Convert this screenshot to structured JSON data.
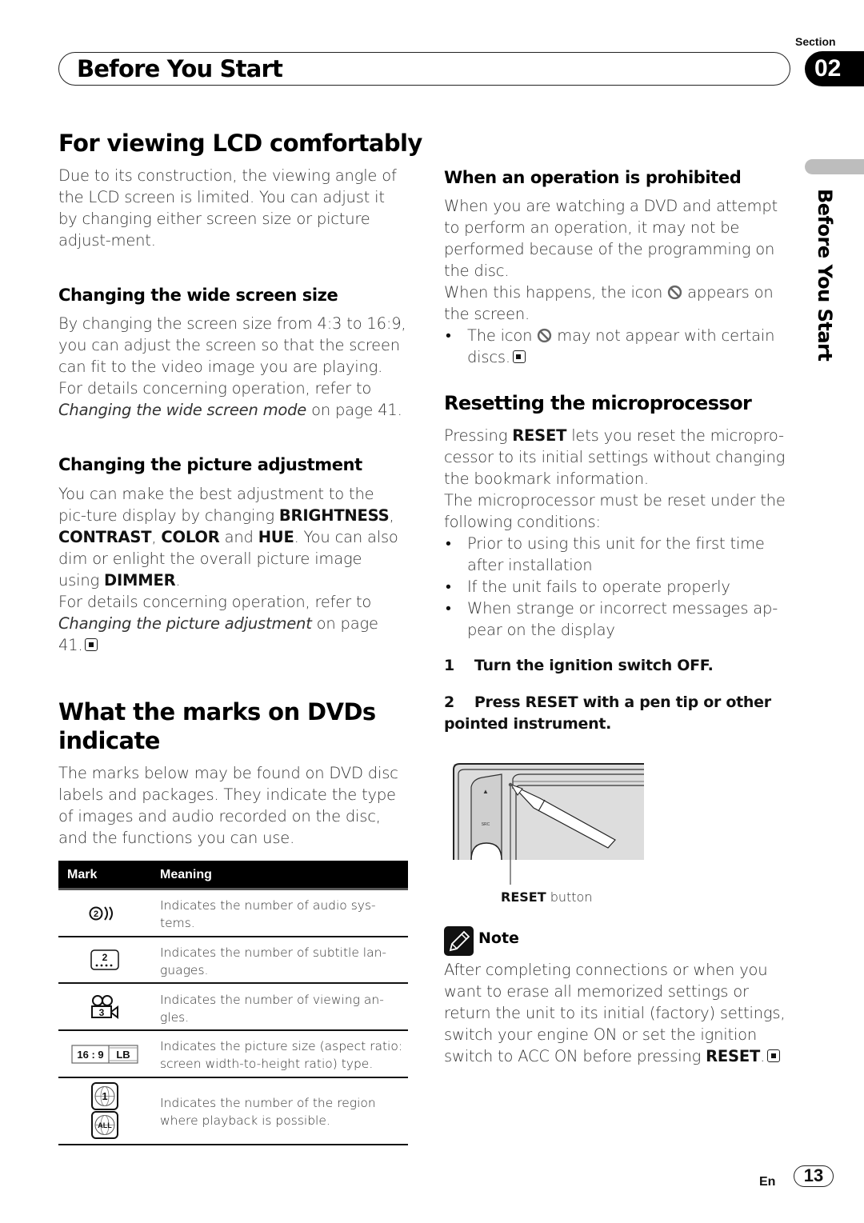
{
  "header": {
    "title": "Before You Start",
    "section_label": "Section",
    "section_number": "02",
    "side_tab": "Before You Start"
  },
  "left": {
    "lcd": {
      "heading": "For viewing LCD comfortably",
      "body": "Due to its construction, the viewing angle of the LCD screen is limited. You can adjust it by changing either screen size or picture adjust-ment."
    },
    "wide": {
      "heading": "Changing the wide screen size",
      "body": "By changing the screen size from 4:3 to 16:9, you can adjust the screen so that the screen can fit to the video image you are playing.",
      "ref_prefix": "For details concerning operation, refer to",
      "ref_link": "Changing the wide screen mode",
      "ref_suffix": " on page 41."
    },
    "picture": {
      "heading": "Changing the picture adjustment",
      "t1": "You can make the best adjustment to the pic-ture display by changing ",
      "k1": "BRIGHTNESS",
      "t2": ", ",
      "k2": "CONTRAST",
      "t3": ", ",
      "k3": "COLOR",
      "t4": " and ",
      "k4": "HUE",
      "t5": ". You can also dim or enlight the overall picture image using ",
      "k5": "DIMMER",
      "t6": ".",
      "ref_prefix": "For details concerning operation, refer to",
      "ref_link": "Changing the picture adjustment",
      "ref_suffix": " on page 41."
    },
    "marks": {
      "heading": "What the marks on DVDs indicate",
      "body": "The marks below may be found on DVD disc labels and packages. They indicate the type of images and audio recorded on the disc, and the functions you can use.",
      "table": {
        "col_mark": "Mark",
        "col_meaning": "Meaning",
        "rows": [
          {
            "icon": "audio-systems-icon",
            "icon_text": "2",
            "meaning": "Indicates the number of audio sys-tems."
          },
          {
            "icon": "subtitle-languages-icon",
            "icon_text": "2",
            "meaning": "Indicates the number of subtitle lan-guages."
          },
          {
            "icon": "viewing-angles-icon",
            "icon_text": "3",
            "meaning": "Indicates the number of viewing an-gles."
          },
          {
            "icon": "aspect-ratio-icon",
            "icon_text": "16 : 9",
            "icon_text2": "LB",
            "meaning": "Indicates the picture size (aspect ratio: screen width-to-height ratio) type."
          },
          {
            "icon": "region-icon",
            "icon_text": "1",
            "icon_text2": "ALL",
            "meaning": "Indicates the number of the region where playback is possible."
          }
        ]
      }
    }
  },
  "right": {
    "prohibited": {
      "heading": "When an operation is prohibited",
      "body1": "When you are watching a DVD and attempt to perform an operation, it may not be performed because of the programming on the disc.",
      "body2a": "When this happens, the icon ",
      "body2b": " appears on the screen.",
      "bullet_a": "The icon ",
      "bullet_b": " may not appear with certain discs."
    },
    "reset": {
      "heading": "Resetting the microprocessor",
      "p1a": "Pressing ",
      "p1k": "RESET",
      "p1b": " lets you reset the micropro-cessor to its initial settings without changing the bookmark information.",
      "p2": "The microprocessor must be reset under the following conditions:",
      "bullets": [
        "Prior to using this unit for the first time after installation",
        "If the unit fails to operate properly",
        "When strange or incorrect messages ap-pear on the display"
      ],
      "step1_num": "1",
      "step1": "Turn the ignition switch OFF.",
      "step2_num": "2",
      "step2": "Press RESET with a pen tip or other pointed instrument.",
      "figure_caption_bold": "RESET",
      "figure_caption": " button",
      "figure_labels": {
        "eject": "▲",
        "src": "SRC"
      }
    },
    "note": {
      "title": "Note",
      "t1": "After completing connections or when you want to erase all memorized settings or return the unit to its initial (factory) settings, switch your engine ON or set the ignition switch to ACC ON before pressing ",
      "k1": "RESET",
      "t2": "."
    }
  },
  "footer": {
    "lang": "En",
    "page": "13"
  }
}
